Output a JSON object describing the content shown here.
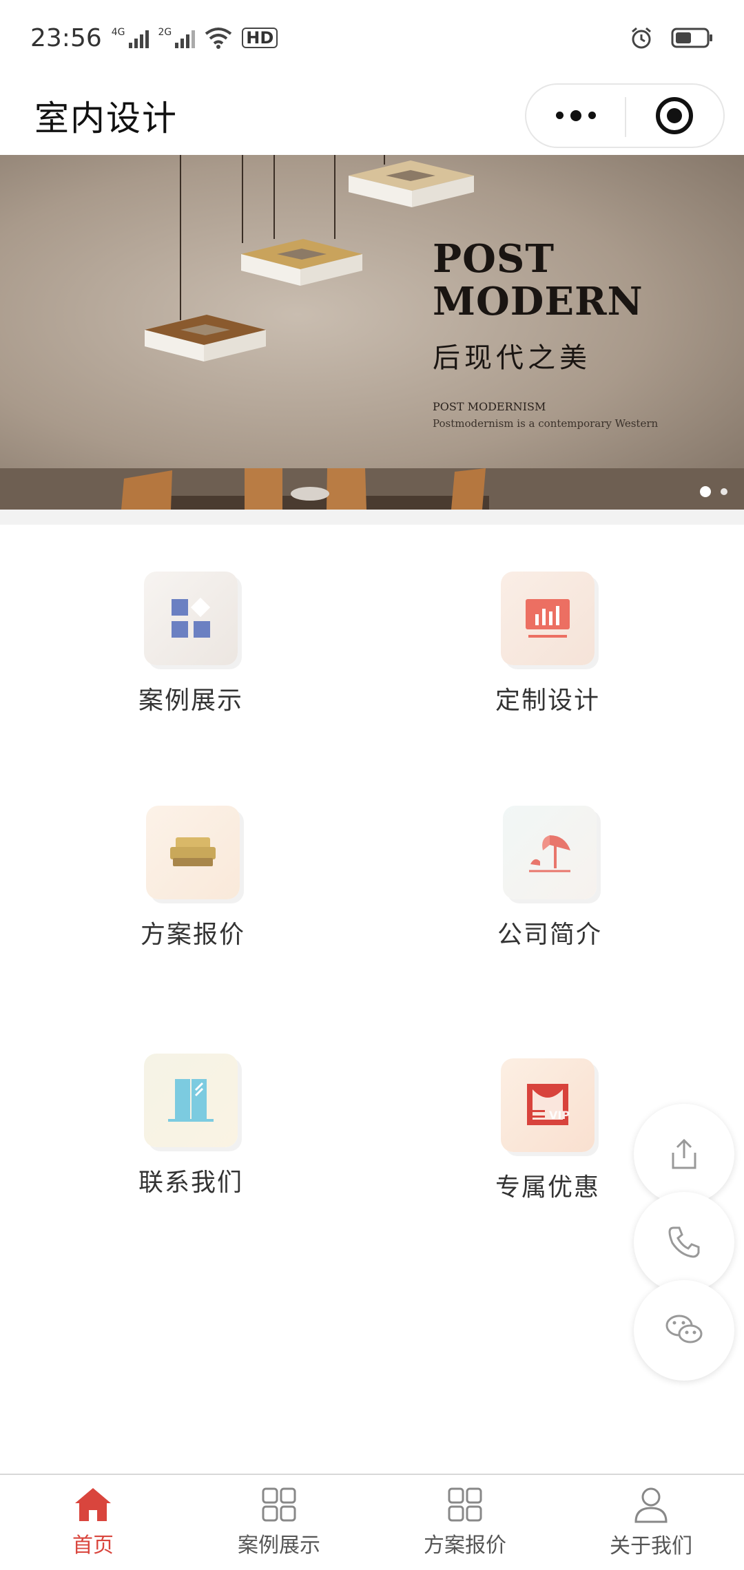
{
  "status_bar": {
    "time": "23:56",
    "signal1_label": "4G",
    "signal2_label": "2G",
    "hd_label": "HD",
    "battery_level": 0.45
  },
  "header": {
    "title": "室内设计"
  },
  "banner": {
    "line1": "POST",
    "line2": "MODERN",
    "subtitle_cn": "后现代之美",
    "small1": "POST MODERNISM",
    "small2": "Postmodernism is a contemporary Western",
    "page_count": 2,
    "active_page": 1
  },
  "grid": {
    "items": [
      {
        "label": "案例展示",
        "icon": "grid-tiles-icon",
        "color": "#6b80c2"
      },
      {
        "label": "定制设计",
        "icon": "chart-board-icon",
        "color": "#ec6f62"
      },
      {
        "label": "方案报价",
        "icon": "sofa-icon",
        "color": "#c9a85a"
      },
      {
        "label": "公司简介",
        "icon": "beach-umbrella-icon",
        "color": "#e8766c"
      },
      {
        "label": "联系我们",
        "icon": "door-icon",
        "color": "#7ccbe0"
      },
      {
        "label": "专属优惠",
        "icon": "vip-curtain-icon",
        "color": "#d8433c"
      }
    ]
  },
  "floating": [
    "share-icon",
    "phone-icon",
    "wechat-icon"
  ],
  "tab_bar": {
    "items": [
      {
        "label": "首页",
        "icon": "home-icon",
        "active": true
      },
      {
        "label": "案例展示",
        "icon": "grid-icon",
        "active": false
      },
      {
        "label": "方案报价",
        "icon": "grid-icon",
        "active": false
      },
      {
        "label": "关于我们",
        "icon": "user-icon",
        "active": false
      }
    ],
    "active_color": "#d9453d",
    "inactive_color": "#888888"
  }
}
